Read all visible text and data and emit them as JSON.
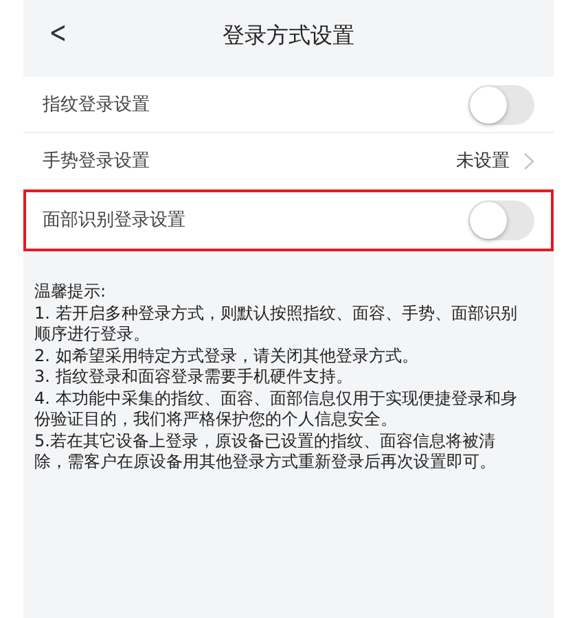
{
  "header": {
    "back_icon": "<",
    "title": "登录方式设置"
  },
  "settings": [
    {
      "kind": "toggle",
      "label": "指纹登录设置",
      "on": false,
      "highlighted": false
    },
    {
      "kind": "link",
      "label": "手势登录设置",
      "value": "未设置",
      "highlighted": false
    },
    {
      "kind": "toggle",
      "label": "面部识别登录设置",
      "on": false,
      "highlighted": true
    }
  ],
  "tips": {
    "title": "温馨提示:",
    "items": [
      "1. 若开启多种登录方式，则默认按照指纹、面容、手势、面部识别顺序进行登录。",
      "2. 如希望采用特定方式登录，请关闭其他登录方式。",
      "3. 指纹登录和面容登录需要手机硬件支持。",
      "4. 本功能中采集的指纹、面容、面部信息仅用于实现便捷登录和身份验证目的，我们将严格保护您的个人信息安全。",
      "5.若在其它设备上登录，原设备已设置的指纹、面容信息将被清除，需客户在原设备用其他登录方式重新登录后再次设置即可。"
    ]
  }
}
